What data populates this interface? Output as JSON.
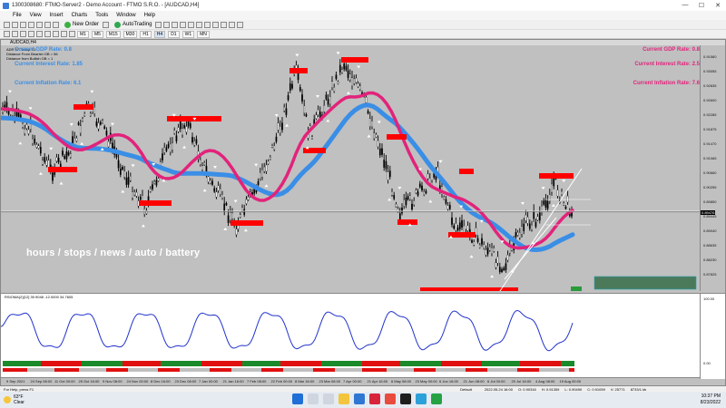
{
  "window": {
    "title": "1300308680: FTMO-Server2 - Demo Account - FTMO S.R.O. - [AUDCAD,H4]",
    "controls": [
      "—",
      "☐",
      "✕"
    ]
  },
  "menu": [
    "File",
    "View",
    "Insert",
    "Charts",
    "Tools",
    "Window",
    "Help"
  ],
  "toolbar": {
    "new_order": "New Order",
    "autotrading": "AutoTrading"
  },
  "timeframes": [
    "M1",
    "M5",
    "M15",
    "M30",
    "H1",
    "H4",
    "D1",
    "W1",
    "MN"
  ],
  "chart": {
    "symbol_label": "AUDCAD,H4",
    "info_lines": [
      "ADR 67  Today: 31",
      "Distance From Bearish OB = 56",
      "Distance from Bullish OB = 1"
    ],
    "left_rates": [
      {
        "label": "Current GDP Rate: 0.8"
      },
      {
        "label": "Current Interest Rate: 1.85"
      },
      {
        "label": "Current Inflation Rate: 6.1"
      }
    ],
    "right_rates": [
      {
        "label": "Current GDP Rate: 0.8"
      },
      {
        "label": "Current Interest Rate: 2.5"
      },
      {
        "label": "Current Inflation Rate: 7.6"
      }
    ],
    "overlay_text": "hours / stops / news / auto / battery",
    "current_price_label": "0.89476",
    "sub_indicator_label": "RSIOMA(2)[12] 39.9048 -12.0000 34.7605",
    "price_ticks": [
      "0.91560",
      "0.93055",
      "0.92835",
      "0.92600",
      "0.92285",
      "0.91875",
      "0.91470",
      "0.91065",
      "0.90660",
      "0.90255",
      "0.89850",
      "0.89445",
      "0.89040",
      "0.88635",
      "0.88230",
      "0.87825"
    ],
    "sub_ticks": [
      "100.00",
      "0.00"
    ],
    "time_ticks": [
      "9 Sep 2021",
      "24 Sep 08:00",
      "11 Oct 00:00",
      "25 Oct 16:00",
      "9 Nov 08:00",
      "24 Nov 00:00",
      "8 Dec 16:00",
      "23 Dec 08:00",
      "7 Jan 00:00",
      "21 Jan 16:00",
      "7 Feb 08:00",
      "22 Feb 00:00",
      "8 Mar 16:00",
      "23 Mar 08:00",
      "7 Apr 00:00",
      "21 Apr 16:00",
      "6 May 08:00",
      "23 May 00:00",
      "6 Jun 16:00",
      "21 Jun 08:00",
      "6 Jul 00:00",
      "20 Jul 16:00",
      "4 Aug 08:00",
      "19 Aug 00:00"
    ],
    "colors": {
      "background": "#c0c0c0",
      "ma_fast": "#e2237b",
      "ma_slow": "#3a8ee6",
      "zone": "#ff0000",
      "candles": "#000000",
      "rsi_line": "#2233cc"
    }
  },
  "status": {
    "help": "For Help, press F1",
    "profile": "Default",
    "datetime_bar": "2022.05.24 16:00",
    "o": "O: 0.90316",
    "h": "H: 0.91359",
    "l": "L: 0.90490",
    "c": "C: 0.91059",
    "v": "V: 25771",
    "traffic": "8733/1 kb"
  },
  "taskbar": {
    "temp": "63°F",
    "weather": "Clear",
    "time": "10:37 PM",
    "date": "8/23/2022"
  }
}
